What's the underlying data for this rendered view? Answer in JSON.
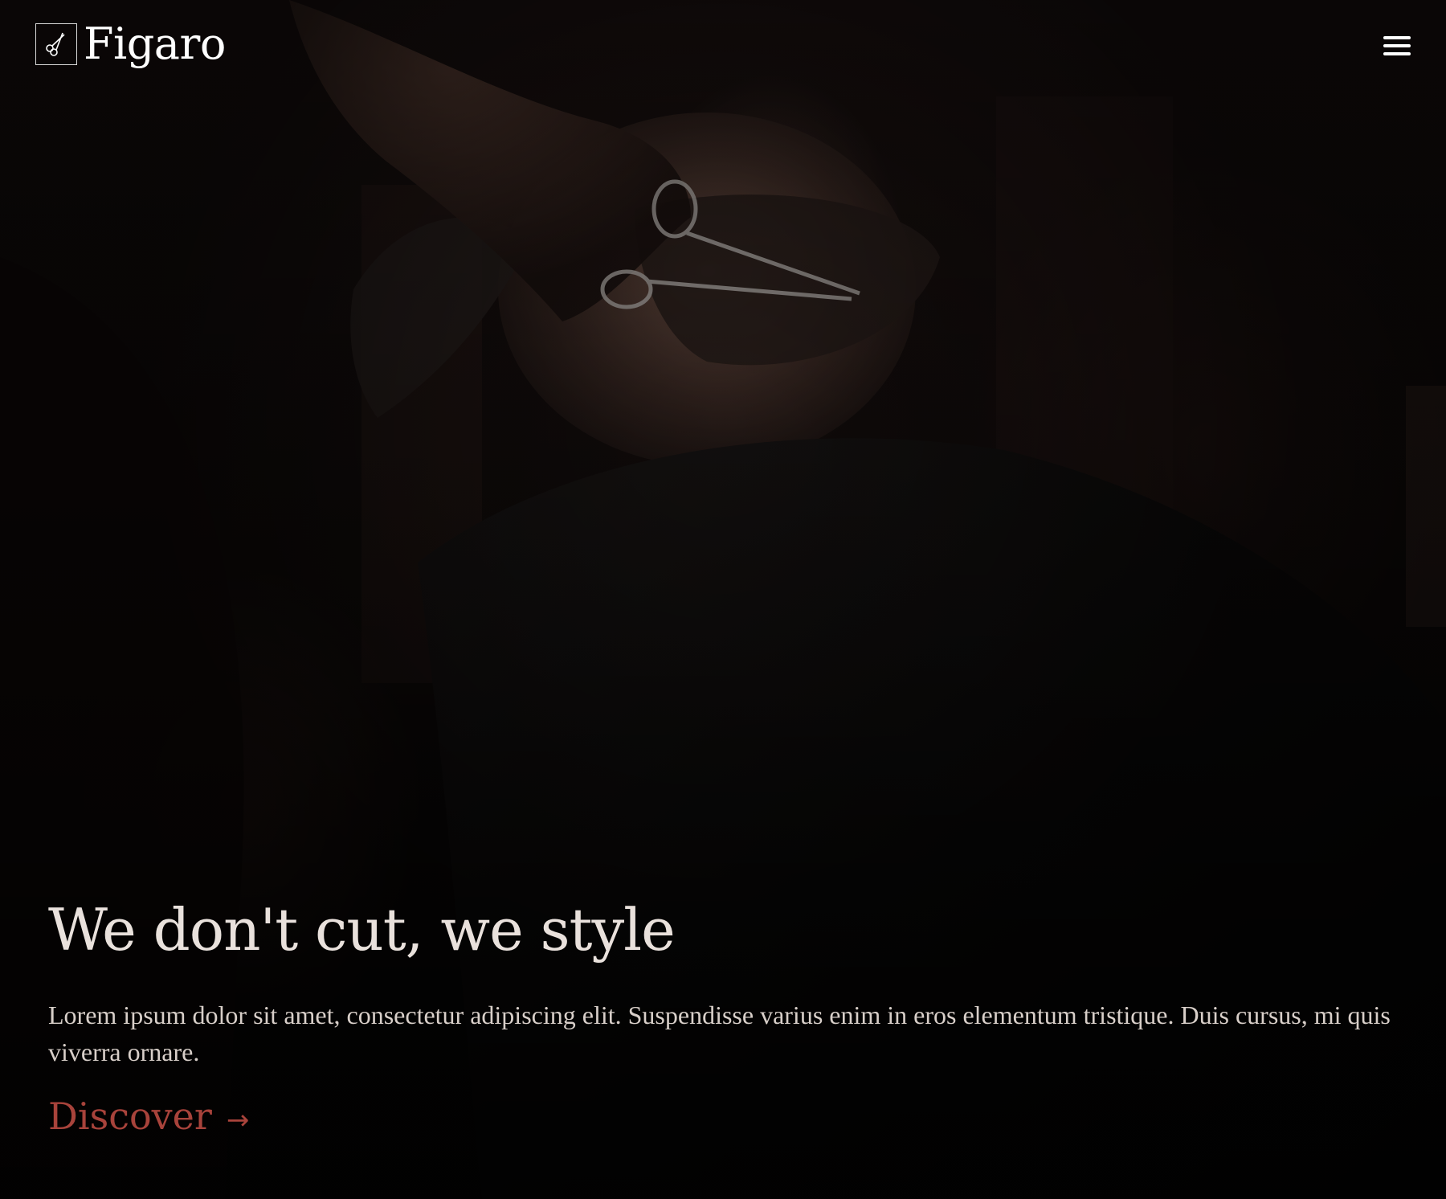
{
  "header": {
    "brand_name": "Figaro",
    "logo_icon": "scissors-icon",
    "menu_icon": "hamburger-menu-icon"
  },
  "hero": {
    "title": "We don't cut, we style",
    "description": "Lorem ipsum dolor sit amet, consectetur adipiscing elit. Suspendisse varius enim in eros elementum tristique. Duis cursus, mi quis viverra ornare.",
    "cta_label": "Discover",
    "cta_arrow": "→"
  },
  "colors": {
    "accent": "#a8433b",
    "text": "#e9e1dc",
    "background": "#0b0908"
  }
}
